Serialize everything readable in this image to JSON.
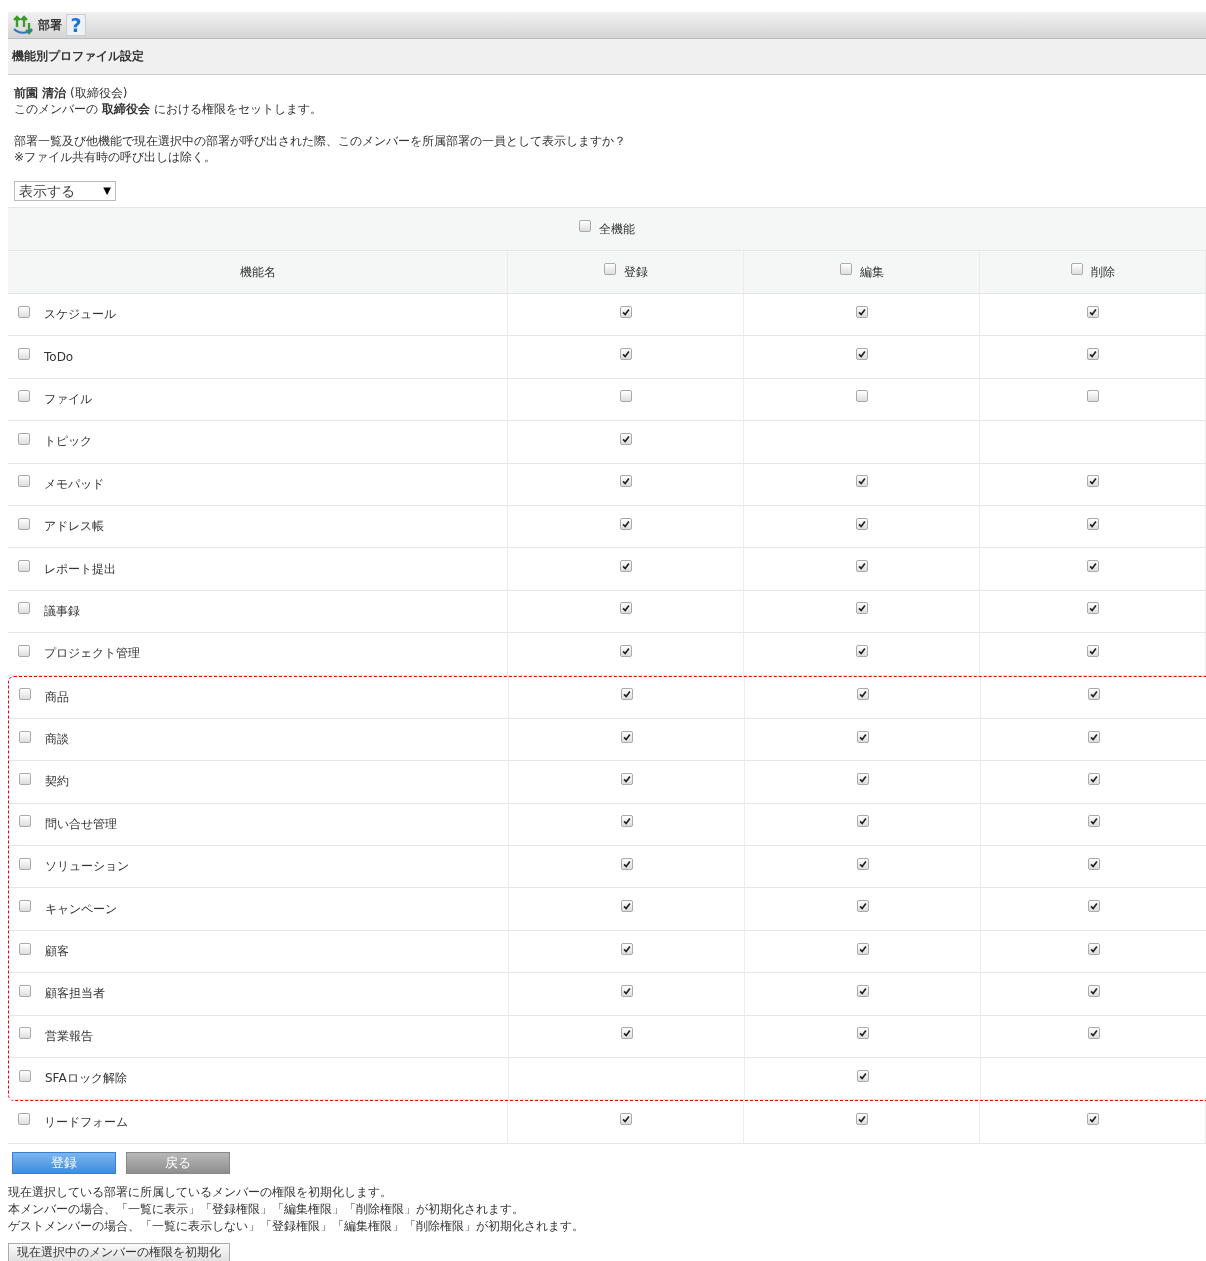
{
  "header": {
    "title": "部署",
    "help": "?"
  },
  "section_title": "機能別プロファイル設定",
  "member_line": "**前園 清治** (取締役会)",
  "scope_line": "このメンバーの **取締役会** における権限をセットします。",
  "question_lines": [
    "部署一覧及び他機能で現在選択中の部署が呼び出された際、このメンバーを所属部署の一員として表示しますか？",
    "※ファイル共有時の呼び出しは除く。"
  ],
  "display_select": {
    "value": "表示する",
    "caret": "▼"
  },
  "all_functions": {
    "label": "全機能",
    "checked": false
  },
  "columns": [
    {
      "label": "機能名"
    },
    {
      "label": "登録",
      "checked": false
    },
    {
      "label": "編集",
      "checked": false
    },
    {
      "label": "削除",
      "checked": false
    }
  ],
  "row_groups": [
    {
      "highlighted": false,
      "rows": [
        {
          "name": "スケジュール",
          "checked": false,
          "register": true,
          "edit": true,
          "delete": true
        },
        {
          "name": "ToDo",
          "checked": false,
          "register": true,
          "edit": true,
          "delete": true
        },
        {
          "name": "ファイル",
          "checked": false,
          "register": false,
          "edit": false,
          "delete": false
        },
        {
          "name": "トピック",
          "checked": false,
          "register": true
        },
        {
          "name": "メモパッド",
          "checked": false,
          "register": true,
          "edit": true,
          "delete": true
        },
        {
          "name": "アドレス帳",
          "checked": false,
          "register": true,
          "edit": true,
          "delete": true
        },
        {
          "name": "レポート提出",
          "checked": false,
          "register": true,
          "edit": true,
          "delete": true
        },
        {
          "name": "議事録",
          "checked": false,
          "register": true,
          "edit": true,
          "delete": true
        },
        {
          "name": "プロジェクト管理",
          "checked": false,
          "register": true,
          "edit": true,
          "delete": true
        }
      ]
    },
    {
      "highlighted": true,
      "rows": [
        {
          "name": "商品",
          "checked": false,
          "register": true,
          "edit": true,
          "delete": true
        },
        {
          "name": "商談",
          "checked": false,
          "register": true,
          "edit": true,
          "delete": true
        },
        {
          "name": "契約",
          "checked": false,
          "register": true,
          "edit": true,
          "delete": true
        },
        {
          "name": "問い合せ管理",
          "checked": false,
          "register": true,
          "edit": true,
          "delete": true
        },
        {
          "name": "ソリューション",
          "checked": false,
          "register": true,
          "edit": true,
          "delete": true
        },
        {
          "name": "キャンペーン",
          "checked": false,
          "register": true,
          "edit": true,
          "delete": true
        },
        {
          "name": "顧客",
          "checked": false,
          "register": true,
          "edit": true,
          "delete": true
        },
        {
          "name": "顧客担当者",
          "checked": false,
          "register": true,
          "edit": true,
          "delete": true
        },
        {
          "name": "営業報告",
          "checked": false,
          "register": true,
          "edit": true,
          "delete": true
        },
        {
          "name": "SFAロック解除",
          "checked": false,
          "edit": true
        }
      ]
    },
    {
      "highlighted": false,
      "rows": [
        {
          "name": "リードフォーム",
          "checked": false,
          "register": true,
          "edit": true,
          "delete": true
        }
      ]
    }
  ],
  "buttons": [
    {
      "label": "登録",
      "kind": "primary"
    },
    {
      "label": "戻る",
      "kind": "secondary"
    }
  ],
  "notes": [
    "現在選択している部署に所属しているメンバーの権限を初期化します。",
    "本メンバーの場合、「一覧に表示」「登録権限」「編集権限」「削除権限」が初期化されます。",
    "ゲストメンバーの場合、「一覧に表示しない」「登録権限」「編集権限」「削除権限」が初期化されます。"
  ],
  "reset_button": {
    "label": "現在選択中のメンバーの権限を初期化"
  }
}
